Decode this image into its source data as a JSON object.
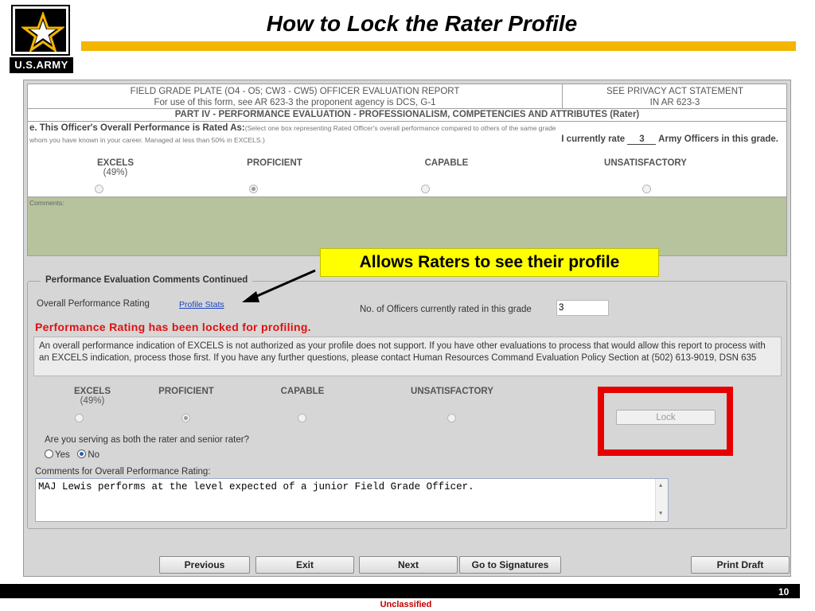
{
  "slide": {
    "title": "How to Lock the Rater Profile",
    "logo_text": "U.S.ARMY",
    "page_number": "10",
    "classification": "Unclassified",
    "colors": {
      "gold": "#f2b500",
      "callout": "#ffff00",
      "highlight": "#e60000",
      "alert": "#e01010"
    }
  },
  "form": {
    "header_left_line1": "FIELD GRADE PLATE (O4 - O5; CW3 - CW5) OFFICER EVALUATION REPORT",
    "header_left_line2": "For use of this form, see AR 623-3 the proponent agency is DCS, G-1",
    "header_right_line1": "SEE PRIVACY ACT STATEMENT",
    "header_right_line2": "IN AR 623-3",
    "part_title": "PART IV - PERFORMANCE EVALUATION - PROFESSIONALISM, COMPETENCIES AND ATTRIBUTES (Rater)",
    "section_e_label": "e. This Officer's Overall Performance is Rated As:",
    "section_e_hint": "(Select one box representing Rated Officer's overall performance compared to others of the same grade",
    "section_e_hint2": "whom you have known in your career. Managed at less than 50% in EXCELS.)",
    "rate_prefix": "I currently rate",
    "rate_count": "3",
    "rate_suffix": "Army Officers in this grade.",
    "options": [
      "EXCELS",
      "PROFICIENT",
      "CAPABLE",
      "UNSATISFACTORY"
    ],
    "excels_pct": "(49%)",
    "selected_option": "PROFICIENT",
    "comments_label": "Comments:"
  },
  "callout": {
    "text": "Allows Raters to see their profile"
  },
  "continued": {
    "legend": "Performance Evaluation Comments Continued",
    "overall_label": "Overall Performance Rating",
    "profile_link": "Profile Stats",
    "officers_label": "No. of Officers currently rated in this grade",
    "officers_value": "3",
    "locked_message": "Performance Rating has been locked for profiling.",
    "notice_text": "An overall performance indication of EXCELS is not authorized as your profile does not support. If you have other evaluations to process that would allow this report to process with an EXCELS indication, process those first. If you have any further questions, please contact Human Resources Command Evaluation Policy Section at (502) 613-9019, DSN 635",
    "options": [
      "EXCELS",
      "PROFICIENT",
      "CAPABLE",
      "UNSATISFACTORY"
    ],
    "excels_pct": "(49%)",
    "lock_label": "Lock",
    "dual_question": "Are you serving as both the rater and senior rater?",
    "yes_label": "Yes",
    "no_label": "No",
    "dual_selected": "No",
    "comments_label": "Comments for Overall Performance Rating:",
    "comments_value": "MAJ Lewis performs at the level expected of a junior Field Grade Officer."
  },
  "buttons": {
    "previous": "Previous",
    "exit": "Exit",
    "next": "Next",
    "signatures": "Go to Signatures",
    "print": "Print Draft"
  }
}
